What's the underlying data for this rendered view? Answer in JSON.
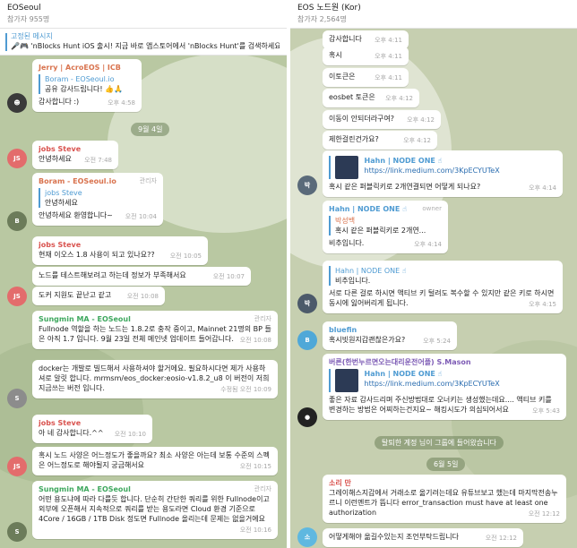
{
  "left": {
    "title": "EOSeoul",
    "subtitle": "참가자 955명",
    "pinned": {
      "label": "고정된 메시지",
      "text": "🎤🎮 'nBlocks Hunt iOS 출시! 지금 바로 앱스토어에서 'nBlocks Hunt'를 검색하세요"
    },
    "messages": {
      "m1": {
        "sender": "Jerry | AcroEOS | ICB",
        "reply_name": "Boram - EOSeoul.io",
        "reply_text": "공유 감사드립니다! 👍🙏",
        "text": "감사합니다 :)",
        "time": "오후 4:58"
      },
      "date1": "9월 4일",
      "m2": {
        "sender": "jobs Steve",
        "text": "안녕하세요",
        "time": "오전 7:48"
      },
      "m3": {
        "sender": "Boram - EOSeoul.io",
        "badge": "관리자",
        "reply_name": "jobs Steve",
        "reply_text": "안녕하세요",
        "text": "안녕하세요 환영합니다~",
        "time": "오전 10:04"
      },
      "m4": {
        "sender": "jobs Steve",
        "text": "현재 이오스 1.8 사용이 되고 있나요??",
        "time": "오전 10:05"
      },
      "m5": {
        "text": "노드를 테스트해보려고 하는데 정보가 부족해서요",
        "time": "오전 10:07"
      },
      "m6": {
        "text": "도커 지원도 끝난고 같고",
        "time": "오전 10:08"
      },
      "m7": {
        "sender": "Sungmin MA - EOSeoul",
        "badge": "관리자",
        "text": "Fullnode 역할을 하는 노드는 1.8.2로 충작 중이고, Mainnet 21명의 BP 들은 아직 1.7 입니다. 9월 23일 전체 메인넷 업데이트 들어갑니다.",
        "time": "오전 10:08"
      },
      "m8": {
        "text": "docker는 개발로 빌드해서 사용하셔야 할거에요. 필요하시다면 제가 사용하셔로 알릿 합니다. mrmsm/eos_docker:eosio-v1.8.2_u8 이 버전이 저희 지금쓰는 버전 입니다.",
        "time": "수정됨 오전 10:09"
      },
      "m9": {
        "sender": "jobs Steve",
        "text": "아 네 감사합니다.^^",
        "time": "오전 10:10"
      },
      "m10": {
        "text": "혹시 노드 사양은 어느정도가 좋을까요? 최소 사양은 아는데 보통 수준의 스펙은 어느정도로 해야될지 궁금해서요",
        "time": "오전 10:15"
      },
      "m11": {
        "sender": "Sungmin MA - EOSeoul",
        "badge": "관리자",
        "text": "어떤 용도냐에 따라 다를듯 합니다. 단순히 간단한 쿼리를 위한 Fullnode이고 외부에 오픈해서 지속적으로 쿼리를 받는 용도라면 Cloud 환경 기준으로 4Core / 16GB / 1TB Disk 정도면 Fullnode 올리는데 문제는 없을거에요",
        "time": "오전 10:16"
      }
    }
  },
  "right": {
    "title": "EOS 노드원 (Kor)",
    "subtitle": "참가자 2,564명",
    "messages": {
      "r1": {
        "text": "감사합니다",
        "time": "오후 4:11"
      },
      "r2": {
        "text": "혹시",
        "time": "오후 4:11"
      },
      "r3": {
        "text": "이토큰은",
        "time": "오후 4:11"
      },
      "r4": {
        "text": "eosbet 토큰은",
        "time": "오후 4:12"
      },
      "r5": {
        "text": "이동이 안되더라구여?",
        "time": "오후 4:12"
      },
      "r6": {
        "text": "제한걸린건가요?",
        "time": "오후 4:12"
      },
      "r7": {
        "link_name": "Hahn | NODE ONE ☝",
        "link_url": "https://link.medium.com/3KpECYUTeX",
        "text": "혹시 같은 퍼블릭키로 2개연결되면 어떻게 되나요?",
        "time": "오후 4:14"
      },
      "r8": {
        "sender": "Hahn | NODE ONE ☝",
        "badge": "owner",
        "reply_name": "박성백",
        "reply_text": "혹시 같은 퍼블릭키로 2개연...",
        "text": "비추입니다.",
        "time": "오후 4:14"
      },
      "r9": {
        "reply_name": "Hahn | NODE ONE ☝",
        "reply_text": "비추입니다.",
        "text": "서로 다른 걸로 하시면 액티브 키 털려도 복수할 수 있지만 같은 키로 하시면 동시에 잃어버리게 됩니다.",
        "time": "오후 4:15"
      },
      "r10": {
        "sender": "bluefin",
        "text": "혹시빗원지갑괜찮은가요?",
        "time": "오후 5:24"
      },
      "r11": {
        "sender": "버른(한번누르면오는대리운전어플) S.Mason",
        "link_name": "Hahn | NODE ONE ☝",
        "link_url": "https://link.medium.com/3KpECYUTeX",
        "text": "좋은 자료 감사드리며 주신방법대로 오너키는 생성했는데요.... 액티브 키를 변경하는 방법은 어찌하는건지요~ 해킹시도가 의심되어서요",
        "time": "오후 5:43"
      },
      "notice": "탈퇴한 계정 님이 그룹에 들어왔습니다",
      "date1": "6월 5일",
      "r12": {
        "sender": "소리 만",
        "text": "그레이해스지갑에서 거래소로 옮기려는데요 유튜브보고 했는데 마지막전송누르니 이런멘트가 뜹니다 error_transaction must have at least one authorization",
        "time": "오전 12:12"
      },
      "r13": {
        "text": "어떻게해야 옮길수있는지 조언부탁드립니다",
        "time": "오전 12:12"
      }
    }
  }
}
